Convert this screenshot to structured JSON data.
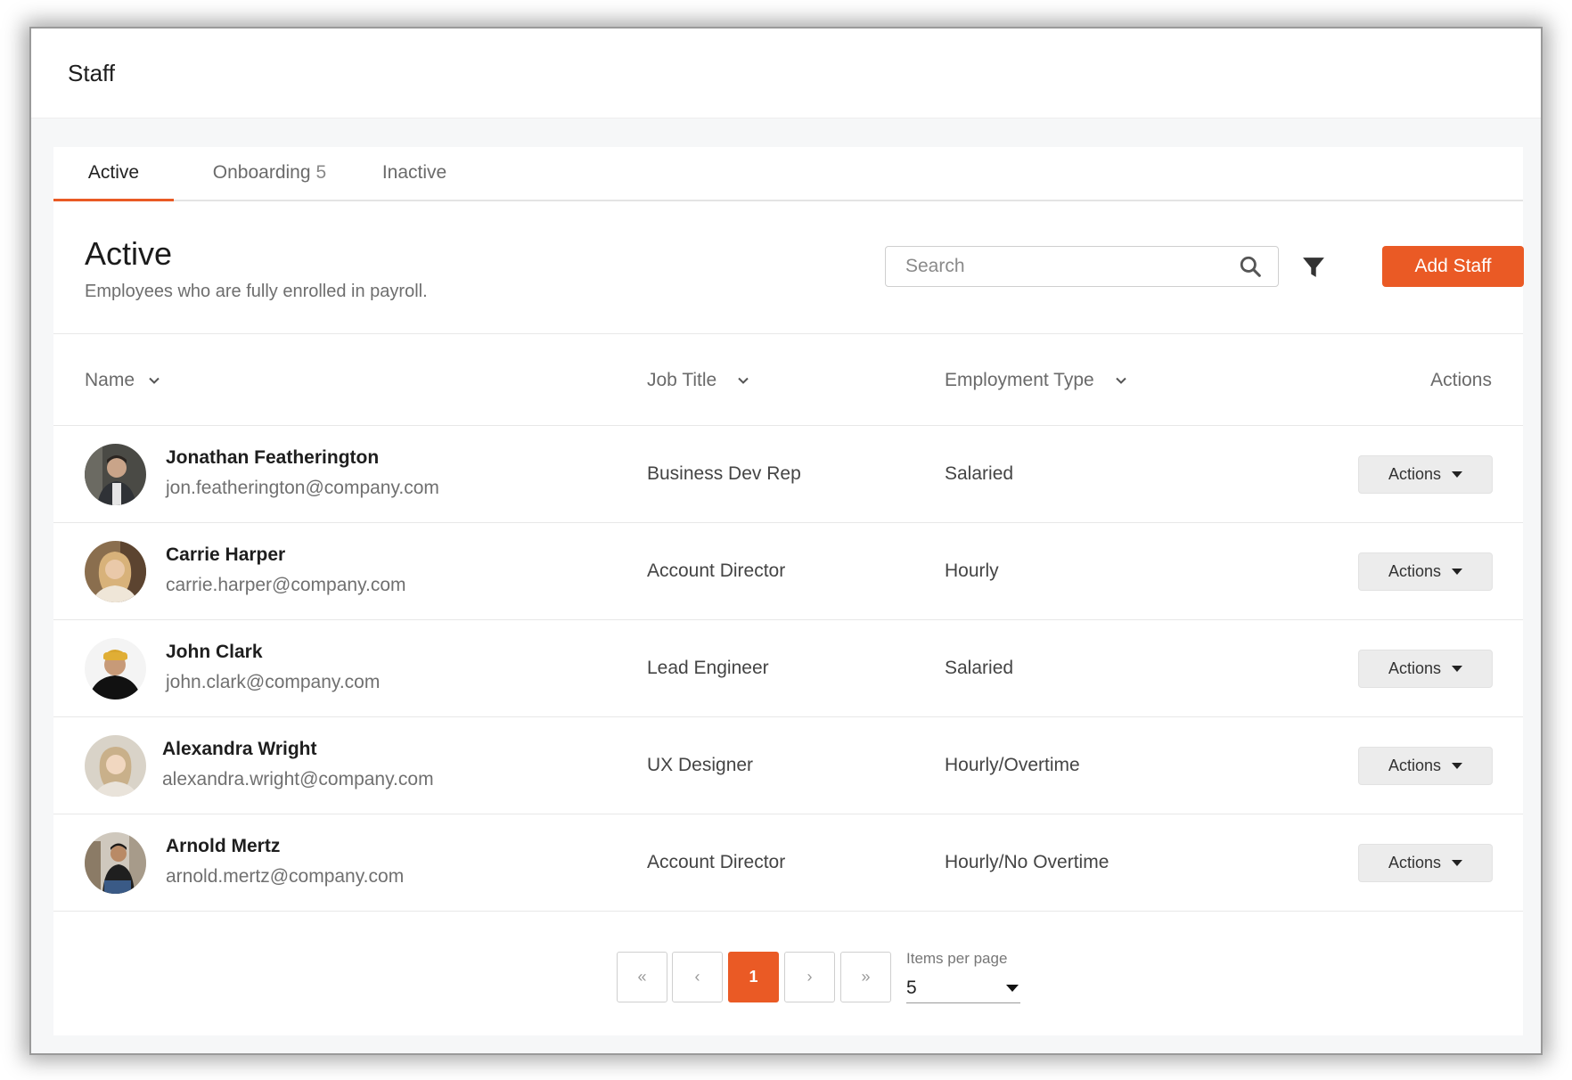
{
  "topbar": {
    "title": "Staff"
  },
  "tabs": [
    {
      "label": "Active",
      "count": ""
    },
    {
      "label": "Onboarding",
      "count": "5"
    },
    {
      "label": "Inactive",
      "count": ""
    }
  ],
  "section": {
    "title": "Active",
    "subtitle": "Employees who are fully enrolled in payroll."
  },
  "search": {
    "placeholder": "Search",
    "value": ""
  },
  "toolbar": {
    "add_label": "Add Staff"
  },
  "colors": {
    "accent": "#ea5a25"
  },
  "table": {
    "headers": {
      "name": "Name",
      "job": "Job Title",
      "employment": "Employment Type",
      "actions": "Actions"
    },
    "rows": [
      {
        "name": "Jonathan Featherington",
        "email": "jon.featherington@company.com",
        "job": "Business Dev Rep",
        "employment": "Salaried",
        "action_label": "Actions"
      },
      {
        "name": "Carrie Harper",
        "email": "carrie.harper@company.com",
        "job": "Account Director",
        "employment": "Hourly",
        "action_label": "Actions"
      },
      {
        "name": "John Clark",
        "email": "john.clark@company.com",
        "job": "Lead Engineer",
        "employment": "Salaried",
        "action_label": "Actions"
      },
      {
        "name": "Alexandra Wright",
        "email": "alexandra.wright@company.com",
        "job": "UX Designer",
        "employment": "Hourly/Overtime",
        "action_label": "Actions"
      },
      {
        "name": "Arnold Mertz",
        "email": "arnold.mertz@company.com",
        "job": "Account Director",
        "employment": "Hourly/No Overtime",
        "action_label": "Actions"
      }
    ]
  },
  "pagination": {
    "first": "«",
    "prev": "‹",
    "current": "1",
    "next": "›",
    "last": "»",
    "items_per_page_label": "Items per page",
    "items_per_page_value": "5"
  }
}
